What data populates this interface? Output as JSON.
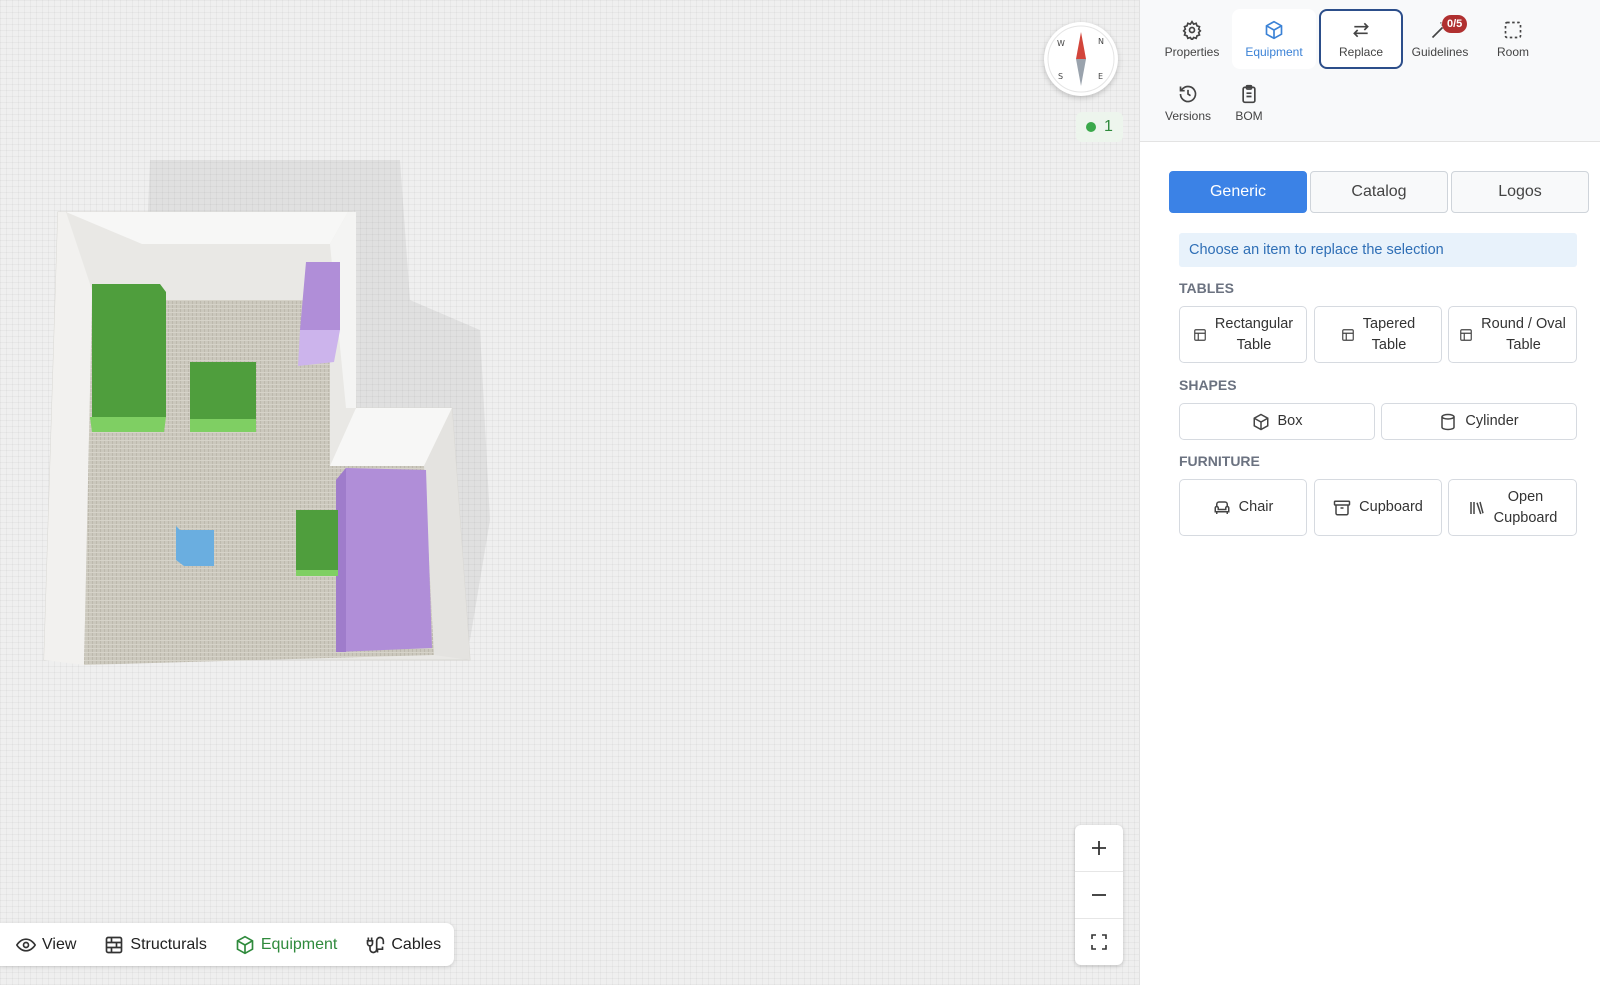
{
  "viewport": {
    "compass": {
      "n": "N",
      "e": "E",
      "s": "S",
      "w": "W"
    },
    "status": {
      "count": "1",
      "color": "#3aa94b"
    },
    "zoom": {
      "in_icon": "plus-icon",
      "out_icon": "minus-icon",
      "fit_icon": "fullscreen-icon"
    },
    "bottom_bar": {
      "view": "View",
      "structurals": "Structurals",
      "equipment": "Equipment",
      "cables": "Cables"
    }
  },
  "toolbar": {
    "properties": "Properties",
    "equipment": "Equipment",
    "replace": "Replace",
    "guidelines": "Guidelines",
    "guidelines_badge": "0/5",
    "room": "Room",
    "versions": "Versions",
    "bom": "BOM"
  },
  "tabs": {
    "generic": "Generic",
    "catalog": "Catalog",
    "logos": "Logos"
  },
  "info": "Choose an item to replace the selection",
  "sections": {
    "tables": {
      "title": "TABLES",
      "items": [
        {
          "line1": "Rectangular",
          "line2": "Table"
        },
        {
          "line1": "Tapered",
          "line2": "Table"
        },
        {
          "line1": "Round / Oval",
          "line2": "Table"
        }
      ]
    },
    "shapes": {
      "title": "SHAPES",
      "items": [
        {
          "label": "Box"
        },
        {
          "label": "Cylinder"
        }
      ]
    },
    "furniture": {
      "title": "FURNITURE",
      "items": [
        {
          "label": "Chair"
        },
        {
          "label": "Cupboard"
        },
        {
          "line1": "Open",
          "line2": "Cupboard"
        }
      ]
    }
  },
  "colors": {
    "accent": "#3b82e6",
    "active_green": "#2f8a3c",
    "badge_red": "#b03030",
    "equipment_green": "#5aaa44",
    "equipment_purple": "#b08ed8",
    "equipment_blue": "#6aaee0"
  }
}
